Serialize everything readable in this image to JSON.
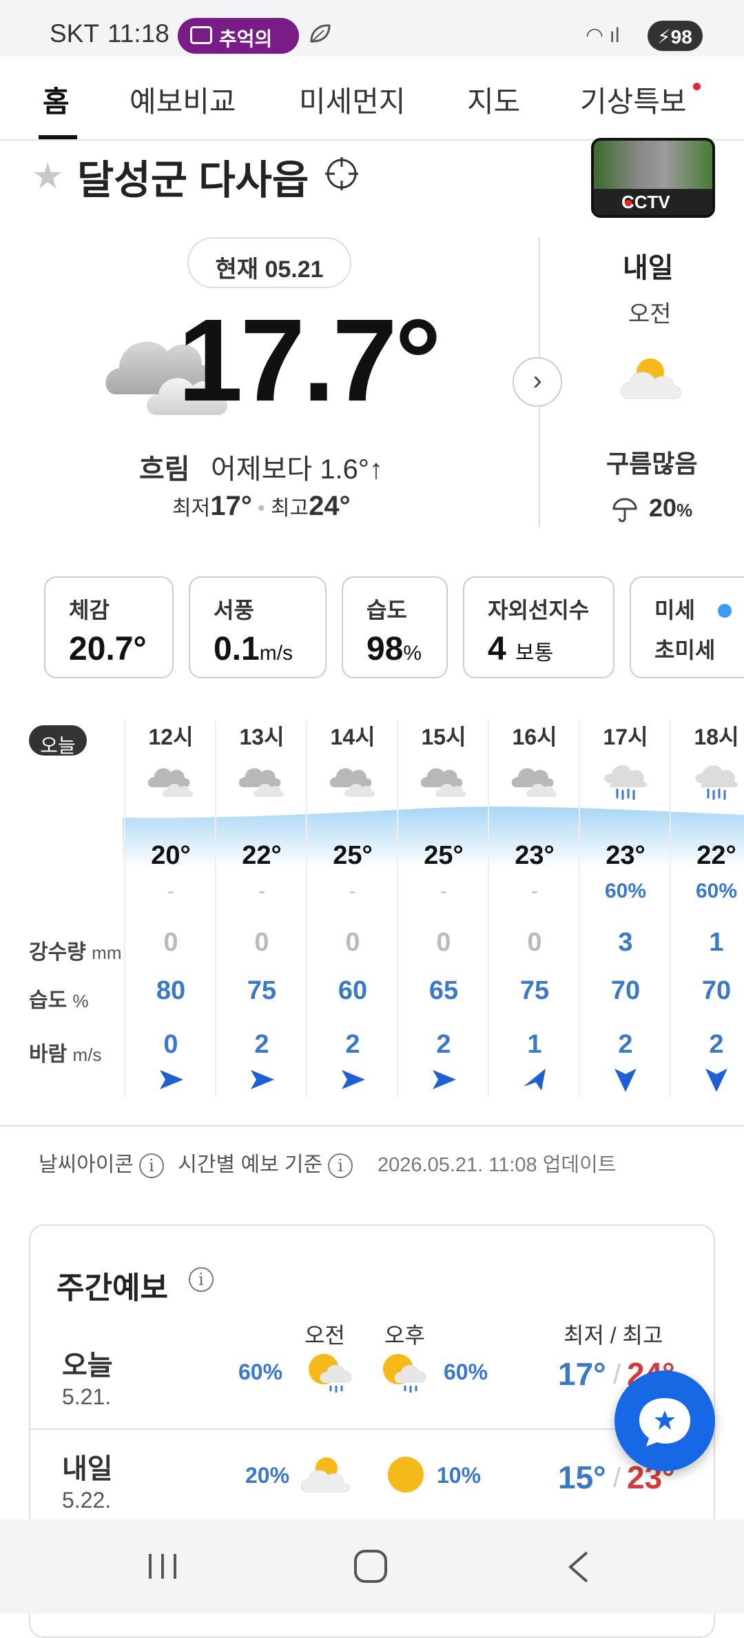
{
  "status_bar": {
    "carrier": "SKT",
    "time": "11:18",
    "media_pill": "추억의",
    "battery": "98"
  },
  "tabs": [
    {
      "label": "홈",
      "active": true
    },
    {
      "label": "예보비교"
    },
    {
      "label": "미세먼지"
    },
    {
      "label": "지도"
    },
    {
      "label": "기상특보",
      "badge": true
    }
  ],
  "location": {
    "name": "달성군 다사읍",
    "cctv_label": "CCTV"
  },
  "current": {
    "date_pill": "현재 05.21",
    "temperature": "17.7°",
    "condition": "흐림",
    "compare": "어제보다 1.6°↑",
    "min_label": "최저",
    "min": "17°",
    "max_label": "최고",
    "max": "24°",
    "icon": "cloudy-icon"
  },
  "tomorrow": {
    "label": "내일",
    "period": "오전",
    "condition": "구름많음",
    "rain_prob": "20",
    "rain_unit": "%",
    "icon": "partly-cloudy-icon"
  },
  "metrics": [
    {
      "label": "체감",
      "value": "20.7°",
      "unit": ""
    },
    {
      "label": "서풍",
      "value": "0.1",
      "unit": "m/s"
    },
    {
      "label": "습도",
      "value": "98",
      "unit": "%"
    },
    {
      "label": "자외선지수",
      "value": "4",
      "unit": "보통"
    },
    {
      "label": "미세",
      "value": "초미세",
      "unit": ""
    }
  ],
  "hourly": {
    "today_badge": "오늘",
    "row_labels": {
      "rain": "강수량",
      "rain_unit": "mm",
      "humidity": "습도",
      "humidity_unit": "%",
      "wind": "바람",
      "wind_unit": "m/s"
    },
    "hours": [
      {
        "hour": "12시",
        "icon": "cloudy-icon",
        "temp": "20°",
        "pop": "-",
        "rain": "0",
        "humidity": "80",
        "wind": "0",
        "dir": "east"
      },
      {
        "hour": "13시",
        "icon": "cloudy-icon",
        "temp": "22°",
        "pop": "-",
        "rain": "0",
        "humidity": "75",
        "wind": "2",
        "dir": "east"
      },
      {
        "hour": "14시",
        "icon": "cloudy-icon",
        "temp": "25°",
        "pop": "-",
        "rain": "0",
        "humidity": "60",
        "wind": "2",
        "dir": "east"
      },
      {
        "hour": "15시",
        "icon": "cloudy-icon",
        "temp": "25°",
        "pop": "-",
        "rain": "0",
        "humidity": "65",
        "wind": "2",
        "dir": "east"
      },
      {
        "hour": "16시",
        "icon": "cloudy-icon",
        "temp": "23°",
        "pop": "-",
        "rain": "0",
        "humidity": "75",
        "wind": "1",
        "dir": "northeast"
      },
      {
        "hour": "17시",
        "icon": "rain-icon",
        "temp": "23°",
        "pop": "60%",
        "rain": "3",
        "humidity": "70",
        "wind": "2",
        "dir": "south"
      },
      {
        "hour": "18시",
        "icon": "rain-icon",
        "temp": "22°",
        "pop": "60%",
        "rain": "1",
        "humidity": "70",
        "wind": "2",
        "dir": "south"
      }
    ]
  },
  "info": {
    "icon_info": "날씨아이콘",
    "forecast_basis": "시간별 예보 기준",
    "updated": "2026.05.21. 11:08 업데이트"
  },
  "weekly": {
    "title": "주간예보",
    "header_am": "오전",
    "header_pm": "오후",
    "header_minmax": "최저 / 최고",
    "days": [
      {
        "day": "오늘",
        "date": "5.21.",
        "am_pop": "60%",
        "pm_pop": "60%",
        "am_icon": "sun-rain-icon",
        "pm_icon": "sun-rain-icon",
        "min": "17°",
        "max": "24°"
      },
      {
        "day": "내일",
        "date": "5.22.",
        "am_pop": "20%",
        "pm_pop": "10%",
        "am_icon": "partly-cloudy-icon",
        "pm_icon": "sun-icon",
        "min": "15°",
        "max": "23°"
      }
    ]
  },
  "colors": {
    "accent_blue": "#3a78c9",
    "max_red": "#d43c3c",
    "fab_blue": "#1668e4",
    "media_pill": "#7a1c86"
  }
}
